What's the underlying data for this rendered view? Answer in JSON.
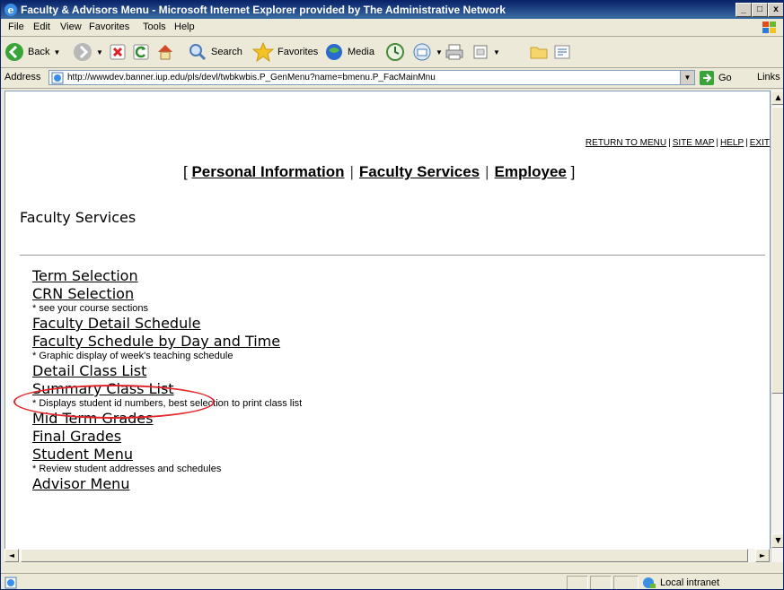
{
  "window": {
    "title": "Faculty & Advisors Menu - Microsoft Internet Explorer provided by The Administrative Network",
    "buttons": [
      "_",
      "□",
      "x"
    ]
  },
  "menubar": [
    "File",
    "Edit",
    "View",
    "Favorites",
    "Tools",
    "Help"
  ],
  "toolbar": {
    "back": "Back",
    "search": "Search",
    "favorites": "Favorites",
    "media": "Media"
  },
  "address": {
    "label": "Address",
    "url": "http://wwwdev.banner.iup.edu/pls/devl/twbkwbis.P_GenMenu?name=bmenu.P_FacMainMnu",
    "go": "Go",
    "links": "Links"
  },
  "page": {
    "toplinks": [
      "RETURN TO MENU",
      "SITE MAP",
      "HELP",
      "EXIT"
    ],
    "tabs": [
      "Personal Information",
      "Faculty Services",
      "Employee"
    ],
    "bracket_open": "[",
    "bracket_close": "]",
    "title": "Faculty Services",
    "menu": [
      {
        "label": "Term Selection",
        "desc": ""
      },
      {
        "label": "CRN Selection",
        "desc": "* see your course sections"
      },
      {
        "label": "Faculty Detail Schedule",
        "desc": ""
      },
      {
        "label": "Faculty Schedule by Day and Time",
        "desc": "* Graphic display of week's teaching schedule"
      },
      {
        "label": "Detail Class List",
        "desc": ""
      },
      {
        "label": "Summary Class List",
        "desc": "* Displays student id numbers, best selection to print class list"
      },
      {
        "label": "Mid Term Grades",
        "desc": ""
      },
      {
        "label": "Final Grades",
        "desc": ""
      },
      {
        "label": "Student Menu",
        "desc": "* Review student addresses and schedules"
      },
      {
        "label": "Advisor Menu",
        "desc": ""
      }
    ]
  },
  "status": {
    "zone": "Local intranet"
  },
  "colors": {
    "highlight_oval": "#e0242a",
    "titlebar": "#0a246a"
  }
}
